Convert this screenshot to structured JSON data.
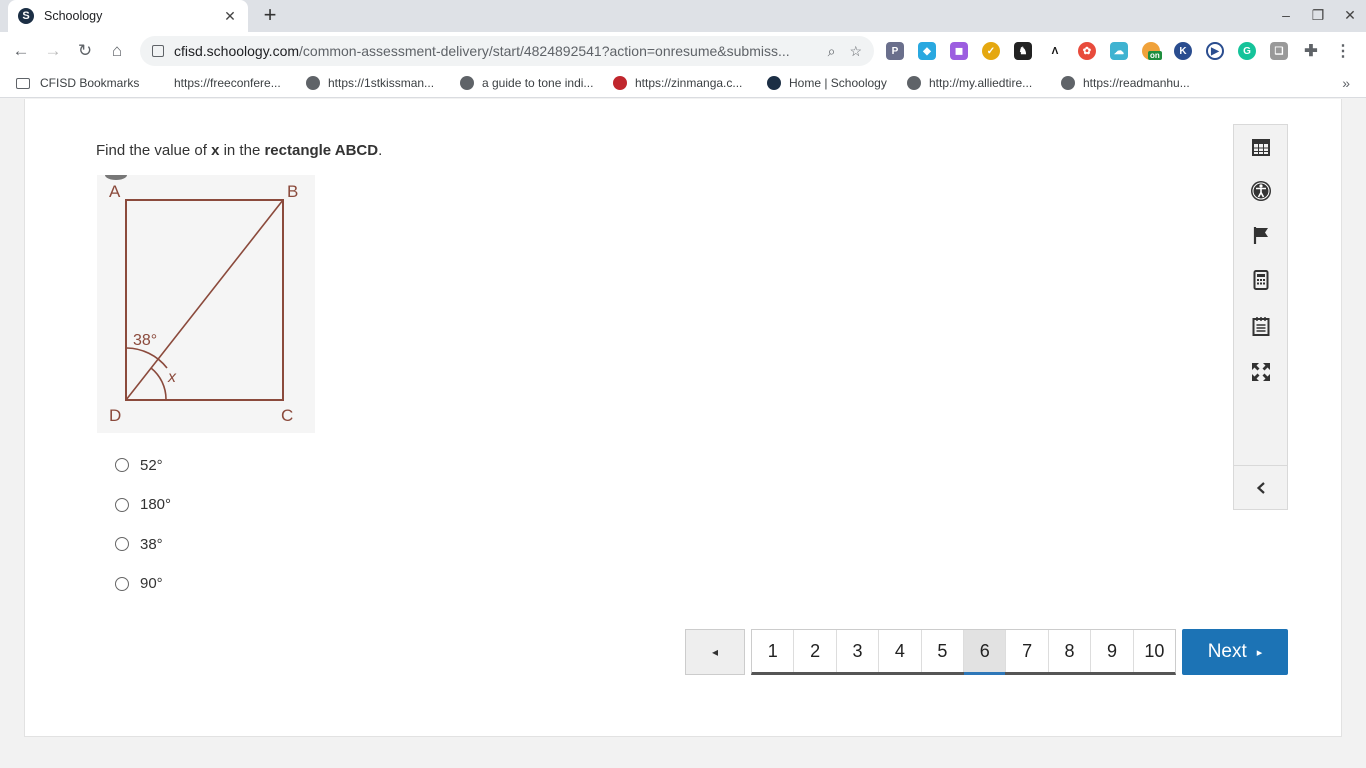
{
  "browser": {
    "tab_title": "Schoology",
    "tab_favicon": "S",
    "url_host": "cfisd.schoology.com",
    "url_rest": "/common-assessment-delivery/start/4824892541?action=onresume&submiss...",
    "bookmarks": [
      "CFISD Bookmarks",
      "https://freeconfere...",
      "https://1stkissman...",
      "a guide to tone indi...",
      "https://zinmanga.c...",
      "Home | Schoology",
      "http://my.alliedtire...",
      "https://readmanhu..."
    ],
    "extension_badge": "on"
  },
  "question": {
    "prefix": "Find the value of ",
    "var": "x",
    "middle": " in the ",
    "shape": "rectangle ABCD",
    "suffix": "."
  },
  "figure": {
    "labels": {
      "a": "A",
      "b": "B",
      "c": "C",
      "d": "D"
    },
    "angle_label": "38°",
    "x_label": "x",
    "stroke_color": "#8b4a3c"
  },
  "choices": [
    "52°",
    "180°",
    "38°",
    "90°"
  ],
  "sidebar_tools": [
    "calendar-icon",
    "accessibility-icon",
    "flag-icon",
    "calculator-icon",
    "notepad-icon",
    "fullscreen-icon",
    "collapse-chevron-icon"
  ],
  "pager": {
    "prev_symbol": "◂",
    "pages": [
      "1",
      "2",
      "3",
      "4",
      "5",
      "6",
      "7",
      "8",
      "9",
      "10"
    ],
    "current": "6",
    "next_label": "Next",
    "next_symbol": "▸"
  },
  "colors": {
    "accent": "#1c73b5",
    "current_marker": "#2e77b8"
  }
}
